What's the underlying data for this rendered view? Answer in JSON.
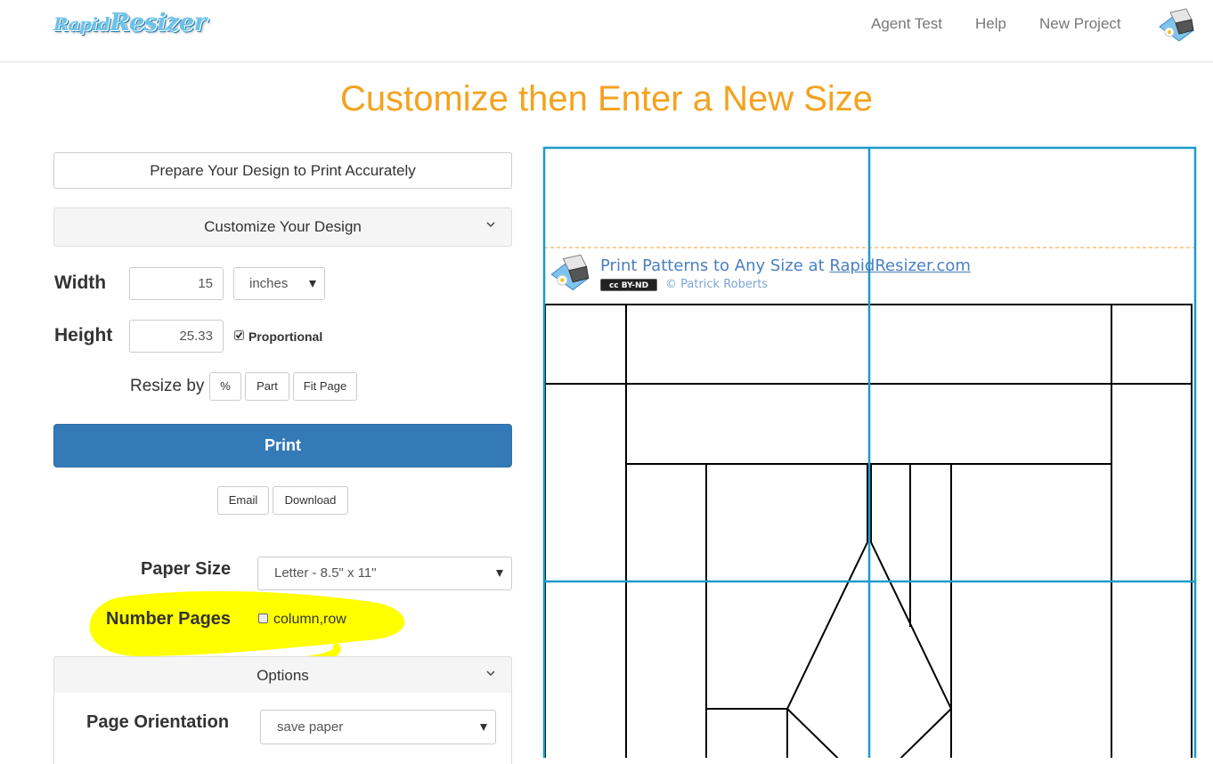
{
  "navbar": {
    "logo": {
      "word1": "Rapid",
      "word2": "Resizer"
    },
    "links": [
      {
        "label": "Agent Test"
      },
      {
        "label": "Help"
      },
      {
        "label": "New Project"
      }
    ]
  },
  "page_title": "Customize then Enter a New Size",
  "panel": {
    "prepare_label": "Prepare Your Design to Print Accurately",
    "customize_label": "Customize Your Design",
    "width": {
      "label": "Width",
      "value": "15",
      "unit": "inches"
    },
    "height": {
      "label": "Height",
      "value": "25.33",
      "proportional_label": "Proportional",
      "proportional_checked": true
    },
    "resize_by": {
      "label": "Resize by",
      "buttons": [
        "%",
        "Part",
        "Fit Page"
      ]
    },
    "print_label": "Print",
    "email_label": "Email",
    "download_label": "Download",
    "paper_size": {
      "label": "Paper Size",
      "value": "Letter - 8.5\" x 11\""
    },
    "number_pages": {
      "label": "Number Pages",
      "option_label": "column,row",
      "checked": false
    },
    "options_label": "Options",
    "page_orientation": {
      "label": "Page Orientation",
      "value": "save paper"
    }
  },
  "preview": {
    "banner_text_prefix": "Print Patterns to Any Size at ",
    "banner_link": "RapidResizer.com",
    "license_badge": "cc BY-ND",
    "credit": "© Patrick Roberts"
  },
  "colors": {
    "title": "#f4a21f",
    "print_button": "#337ab7",
    "page_grid": "#1a9cc8",
    "highlight": "#ffff00"
  }
}
